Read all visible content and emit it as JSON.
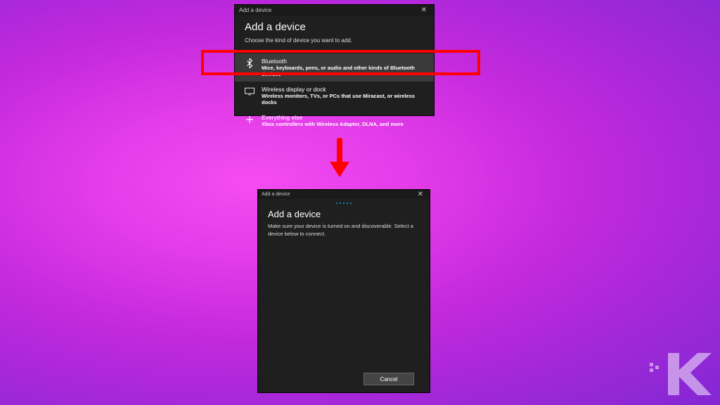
{
  "dialog1": {
    "titlebar": "Add a device",
    "heading": "Add a device",
    "subtext": "Choose the kind of device you want to add.",
    "options": [
      {
        "title": "Bluetooth",
        "desc": "Mice, keyboards, pens, or audio and other kinds of Bluetooth devices"
      },
      {
        "title": "Wireless display or dock",
        "desc": "Wireless monitors, TVs, or PCs that use Miracast, or wireless docks"
      },
      {
        "title": "Everything else",
        "desc": "Xbox controllers with Wireless Adapter, DLNA, and more"
      }
    ]
  },
  "dialog2": {
    "titlebar": "Add a device",
    "heading": "Add a device",
    "subtext": "Make sure your device is turned on and discoverable. Select a device below to connect.",
    "cancel": "Cancel"
  }
}
